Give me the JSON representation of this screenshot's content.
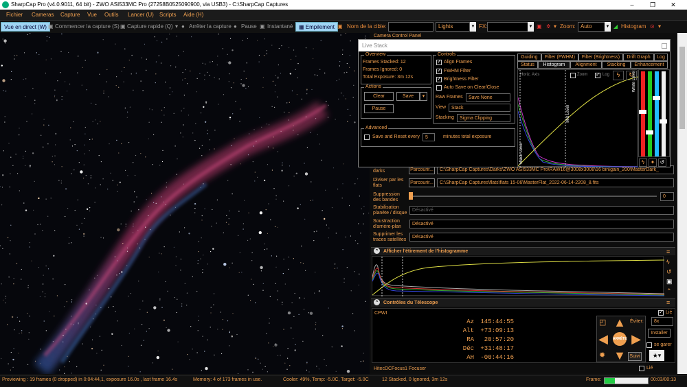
{
  "window": {
    "title": "SharpCap Pro (v4.0.9011, 64 bit) - ZWO ASI533MC Pro (27258B0525090900, via USB3) - C:\\SharpCap Captures",
    "min": "–",
    "max": "❐",
    "close": "✕"
  },
  "menu": [
    "Fichier",
    "Cameras",
    "Capture",
    "Vue",
    "Outils",
    "Lancer (U)",
    "Scripts",
    "Aide (H)"
  ],
  "toolbar": {
    "live": "Vue en direct (W)",
    "start": "Commencer la capture (S)",
    "quick": "Capture rapide (Q)",
    "stop": "Arrêter la capture",
    "pause": "Pause",
    "snapshot": "Instantané",
    "stack": "Empilement",
    "target_label": "Nom de la cible:",
    "target_value": "",
    "frame_type": "Lights",
    "fx_label": "FX:",
    "fx_value": "",
    "zoom_label": "Zoom:",
    "zoom_value": "Auto",
    "histogram": "Histogram"
  },
  "ccp": {
    "title": "Camera Control Panel"
  },
  "livestack": {
    "title": "Live Stack",
    "overview": {
      "title": "Overview",
      "stacked": "Frames Stacked:  12",
      "ignored": "Frames Ignored:  0",
      "exposure": "Total Exposure:    3m 12s"
    },
    "actions": {
      "title": "Actions",
      "clear": "Clear",
      "save": "Save",
      "pause": "Pause"
    },
    "controls": {
      "title": "Controls",
      "align": "Align Frames",
      "fwhm": "FWHM Filter",
      "brightness": "Brightness Filter",
      "autosave": "Auto Save on Clear/Close",
      "raw_label": "Raw Frames",
      "raw_value": "Save None",
      "view_label": "View",
      "view_value": "Stack",
      "stacking_label": "Stacking",
      "stacking_value": "Sigma Clipping"
    },
    "advanced": {
      "title": "Advanced",
      "save_reset": "Save and Reset every",
      "minutes": "5",
      "minutes_label": "minutes total exposure"
    },
    "tabs_row1": [
      "Guiding",
      "Filter (FWHM)",
      "Filter (Brightness)",
      "Drift Graph",
      "Log"
    ],
    "tabs_row2": [
      "Status",
      "Histogram",
      "Alignment",
      "Stacking",
      "Enhancement"
    ],
    "hist": {
      "horiz": "Horiz. Axis",
      "zoom": "Zoom",
      "log": "Log",
      "black": "Black Level",
      "mid": "Mid Level",
      "white": "White Level"
    }
  },
  "processing": {
    "darks_label": "darks",
    "browse": "Parcourir...",
    "darks_path": "C:\\SharpCap Captures\\Darks\\ZWO ASI533MC Pro\\RAW16@3008x3008\\16 bin\\gain_200\\MasterDark_",
    "flats_label": "Diviser par les flats",
    "flats_path": "C:\\SharpCap Captures\\flats\\flats 15-06\\MasterFlat_2022-06-14-2208_8.fits",
    "banding_label": "Suppression des bandes",
    "banding_value": "0",
    "stab_label": "Stabilisation planète / disque",
    "stab_value": "Désactivé",
    "bg_label": "Soustraction d'arrière-plan",
    "bg_value": "Désactivé",
    "sat_label": "Supprimer les traces satellites",
    "sat_value": "Désactivé"
  },
  "histogram_section": {
    "title": "Afficher l'étirement de l'histogramme"
  },
  "telescope": {
    "title": "Contrôles du Télescope",
    "mount": "CPWI",
    "linked": "Lié",
    "az_label": "Az",
    "az": "145:44:55",
    "alt_label": "Alt",
    "alt": "+73:09:13",
    "ra_label": "RA",
    "ra": "20:57:20",
    "dec_label": "Déc",
    "dec": "+31:48:17",
    "ah_label": "AH",
    "ah": "-00:44:16",
    "avoid_label": "Éviter:",
    "avoid_value": "8x",
    "install": "Installer",
    "park": "se garer",
    "stop": "ARRÊTE",
    "follow": "Suivi"
  },
  "focuser": {
    "name": "HitecDCFocus1 Focuser",
    "linked": "Lié"
  },
  "status": {
    "preview": "Previewing : 19 frames (0 dropped) in 0:04:44,1, exposure 16.0s , last frame 16.4s",
    "memory": "Memory: 4 of 173 frames in use.",
    "cooler": "Cooler: 49%, Temp: -5.0C, Target: -5.0C",
    "stack": "12 Stacked, 0 Ignored, 3m 12s",
    "frame_label": "Frame:",
    "time": "00:03/00:13"
  },
  "colors": {
    "accent": "#f0a050",
    "live_button": "#9fd5f5",
    "stack_button": "#9fd5f5",
    "progress": "#22cc44"
  }
}
